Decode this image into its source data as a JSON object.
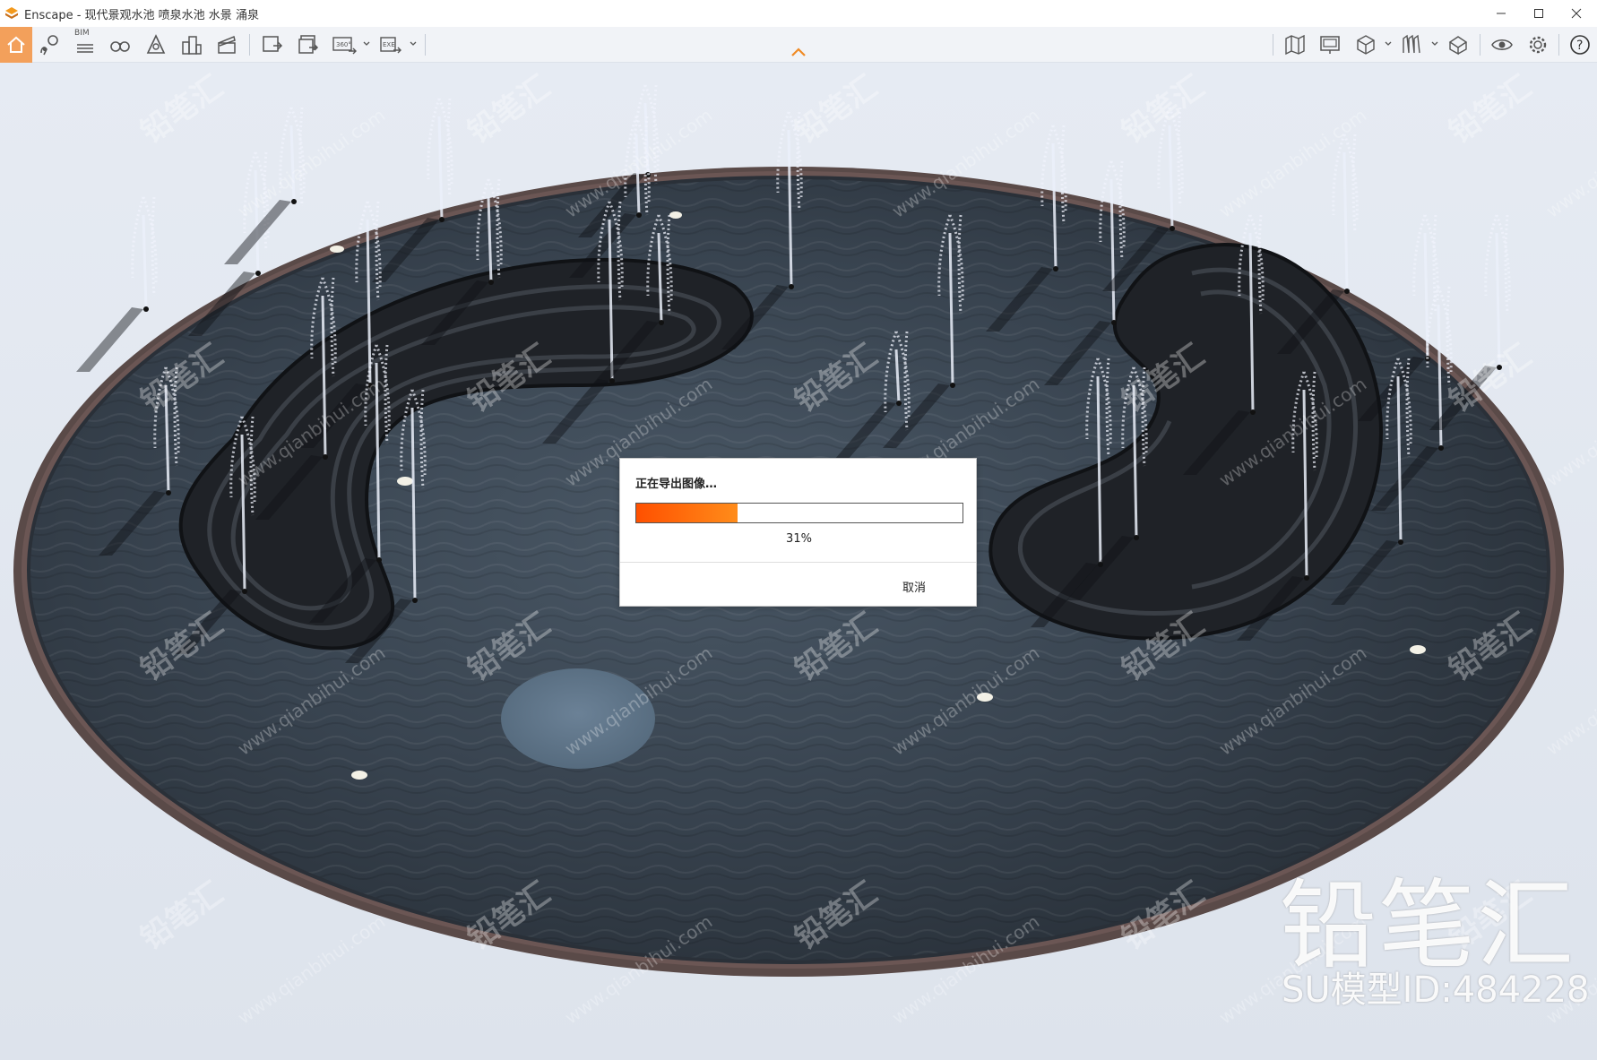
{
  "window": {
    "title": "Enscape - 现代景观水池 喷泉水池 水景 涌泉",
    "app_icon": "enscape-logo-icon",
    "controls": [
      "minimize-icon",
      "maximize-icon",
      "close-icon"
    ]
  },
  "toolbar": {
    "bim_label": "BIM",
    "left_tools": [
      {
        "name": "home-icon",
        "active": true
      },
      {
        "name": "map-pin-icon"
      },
      {
        "name": "bim-list-icon"
      },
      {
        "name": "binoculars-icon"
      },
      {
        "name": "atmosphere-icon"
      },
      {
        "name": "buildings-icon"
      },
      {
        "name": "clapperboard-icon"
      },
      {
        "name": "screenshot-export-icon"
      },
      {
        "name": "batch-export-icon"
      },
      {
        "name": "panorama-360-icon"
      },
      {
        "name": "exe-export-icon"
      }
    ],
    "right_tools": [
      {
        "name": "map-view-icon"
      },
      {
        "name": "presentation-icon"
      },
      {
        "name": "cube-view-icon"
      },
      {
        "name": "material-library-icon"
      },
      {
        "name": "asset-library-icon"
      },
      {
        "name": "visibility-icon"
      },
      {
        "name": "settings-gear-icon"
      },
      {
        "name": "help-icon"
      }
    ],
    "collapse_icon": "chevron-up-icon",
    "accent_color": "#f3a05b"
  },
  "dialog": {
    "title": "正在导出图像…",
    "progress_percent": 31,
    "progress_label": "31%",
    "cancel_label": "取消",
    "progress_color": "#ff6a00"
  },
  "watermark": {
    "brand": "铅笔汇",
    "model_id": "SU模型ID:484228",
    "tile_text": "铅笔汇",
    "tile_url": "www.qianbihui.com"
  }
}
